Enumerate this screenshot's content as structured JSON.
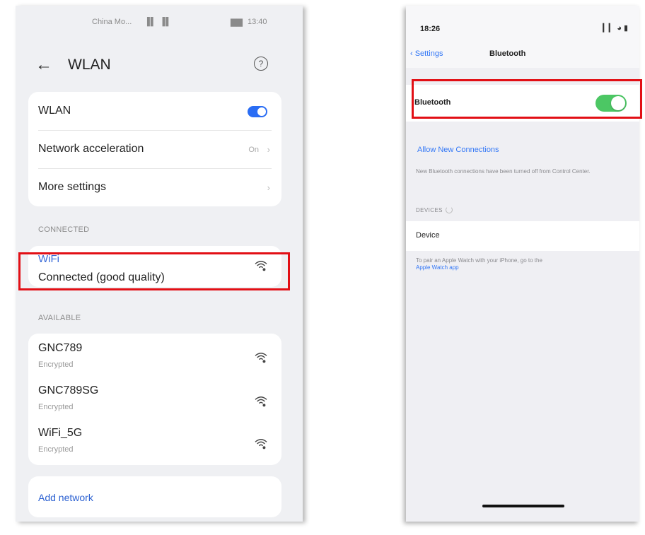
{
  "colors": {
    "highlight": "#e20f15",
    "android_toggle": "#2a6df4",
    "ios_toggle": "#4cc764",
    "ios_link": "#3478f6"
  },
  "left_phone": {
    "status": {
      "carrier": "China Mo...",
      "signal": "▐▌ ▐▌",
      "battery": "▇▇",
      "time": "13:40"
    },
    "header": {
      "back_icon": "back-arrow-icon",
      "back_glyph": "←",
      "title": "WLAN",
      "help_glyph": "?"
    },
    "settings": {
      "wlan": {
        "label": "WLAN",
        "toggle_on": true
      },
      "network_acceleration": {
        "label": "Network acceleration",
        "value": "On"
      },
      "more_settings": {
        "label": "More settings"
      },
      "chevron": "›"
    },
    "connected": {
      "header": "CONNECTED",
      "network": {
        "name": "WiFi",
        "status": "Connected (good quality)"
      }
    },
    "available": {
      "header": "AVAILABLE",
      "networks": [
        {
          "name": "GNC789",
          "status": "Encrypted"
        },
        {
          "name": "GNC789SG",
          "status": "Encrypted"
        },
        {
          "name": "WiFi_5G",
          "status": "Encrypted"
        }
      ]
    },
    "add_network": {
      "label": "Add network"
    }
  },
  "right_phone": {
    "status": {
      "time": "18:26",
      "icons": "▎▎ ◕ ▮"
    },
    "nav": {
      "back_label": "‹ Settings",
      "title": "Bluetooth"
    },
    "bluetooth": {
      "label": "Bluetooth",
      "toggle_on": true
    },
    "allow_new_connections": "Allow New Connections",
    "note": "New Bluetooth connections have been turned off from Control Center.",
    "devices_header": "DEVICES",
    "device": {
      "label": "Device"
    },
    "watch_note": "To pair an Apple Watch with your iPhone, go to the",
    "watch_link": "Apple Watch app"
  }
}
